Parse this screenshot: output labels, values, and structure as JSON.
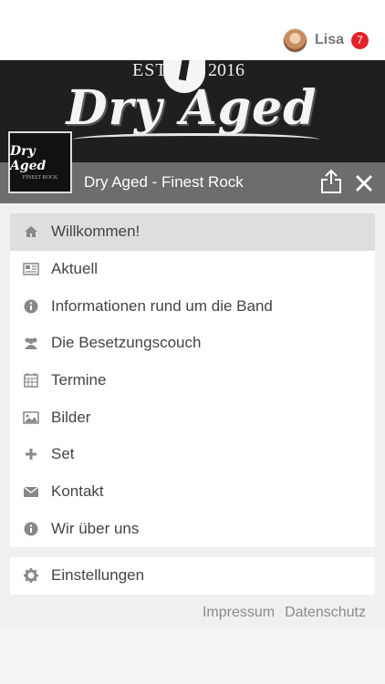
{
  "user": {
    "name": "Lisa",
    "notifications": "7"
  },
  "banner": {
    "est": "EST.",
    "year": "2016",
    "title": "Dry Aged"
  },
  "logo": {
    "title": "Dry Aged",
    "subtitle": "FINEST ROCK"
  },
  "titlebar": {
    "title": "Dry Aged - Finest Rock"
  },
  "menu": {
    "items": [
      {
        "label": "Willkommen!",
        "icon": "home-icon",
        "active": true
      },
      {
        "label": "Aktuell",
        "icon": "newspaper-icon"
      },
      {
        "label": "Informationen rund um die Band",
        "icon": "info-icon"
      },
      {
        "label": "Die Besetzungscouch",
        "icon": "users-icon"
      },
      {
        "label": "Termine",
        "icon": "calendar-icon"
      },
      {
        "label": "Bilder",
        "icon": "image-icon"
      },
      {
        "label": "Set",
        "icon": "plus-icon"
      },
      {
        "label": "Kontakt",
        "icon": "envelope-icon"
      },
      {
        "label": "Wir über uns",
        "icon": "info-icon"
      }
    ]
  },
  "settings": {
    "label": "Einstellungen",
    "icon": "gear-icon"
  },
  "footer": {
    "impressum": "Impressum",
    "datenschutz": "Datenschutz"
  },
  "colors": {
    "titlebar": "#6d6d6d",
    "badge": "#e0252a",
    "active_row": "#dedede"
  }
}
